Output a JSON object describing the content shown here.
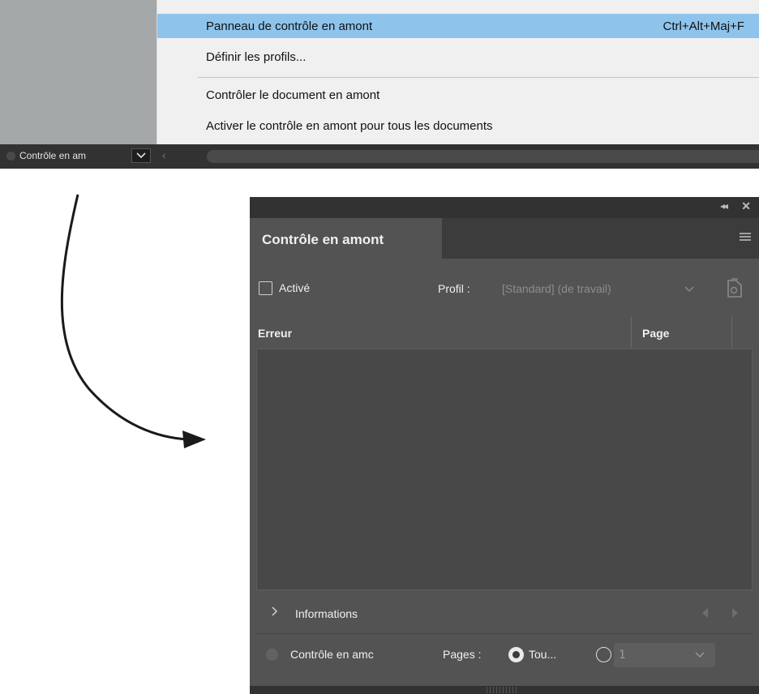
{
  "menu": {
    "items": [
      {
        "label": "Panneau de contrôle en amont",
        "shortcut": "Ctrl+Alt+Maj+F"
      },
      {
        "label": "Définir les profils..."
      },
      {
        "label": "Contrôler le document en amont"
      },
      {
        "label": "Activer le contrôle en amont pour tous les documents"
      }
    ],
    "highlight_color": "#8ec4ec"
  },
  "statusbar": {
    "label": "Contrôle en am",
    "dropdown_icon": "chevron-down-icon",
    "scroll_left_icon": "chevron-left-icon"
  },
  "panel": {
    "title": "Contrôle en amont",
    "collapse_icon": "double-chevron-icon",
    "close_icon": "close-icon",
    "menu_icon": "hamburger-icon",
    "enabled_label": "Activé",
    "enabled_checked": false,
    "profile_label": "Profil :",
    "profile_value": "[Standard] (de travail)",
    "profile_icon": "profile-document-icon",
    "columns": {
      "error": "Erreur",
      "page": "Page"
    },
    "info_label": "Informations",
    "bottom": {
      "status_label": "Contrôle en amc",
      "pages_label": "Pages :",
      "option_all": "Tou...",
      "option_all_selected": true,
      "page_value": "1"
    }
  }
}
